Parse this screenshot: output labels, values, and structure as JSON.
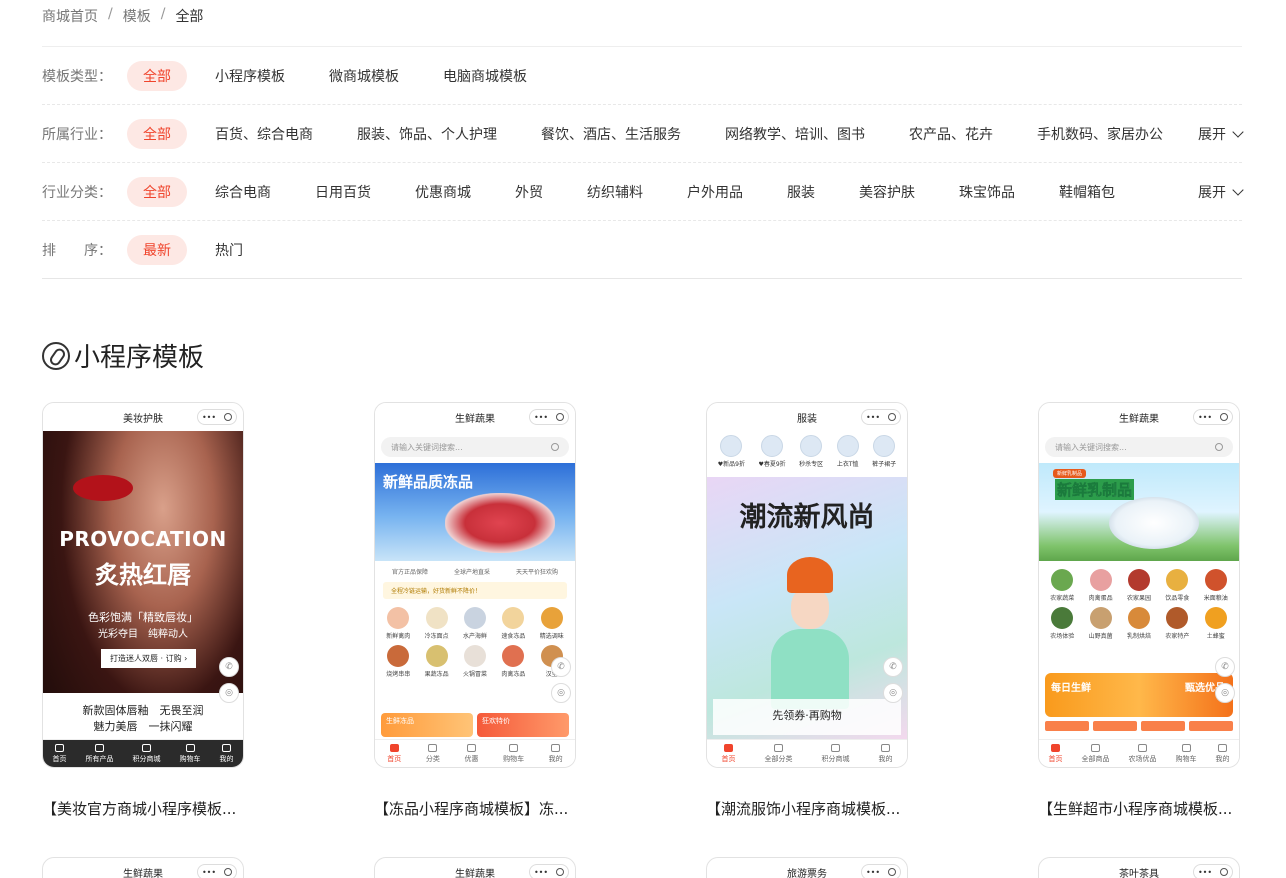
{
  "breadcrumb": [
    "商城首页",
    "模板",
    "全部"
  ],
  "filters": [
    {
      "label": "模板类型：",
      "options": [
        "全部",
        "小程序模板",
        "微商城模板",
        "电脑商城模板"
      ],
      "more": ""
    },
    {
      "label": "所属行业：",
      "options": [
        "全部",
        "百货、综合电商",
        "服装、饰品、个人护理",
        "餐饮、酒店、生活服务",
        "网络教学、培训、图书",
        "农产品、花卉",
        "手机数码、家居办公"
      ],
      "more": "展开"
    },
    {
      "label": "行业分类：",
      "options": [
        "全部",
        "综合电商",
        "日用百货",
        "优惠商城",
        "外贸",
        "纺织辅料",
        "户外用品",
        "服装",
        "美容护肤",
        "珠宝饰品",
        "鞋帽箱包"
      ],
      "more": "展开"
    },
    {
      "label": "排　　序：",
      "options": [
        "最新",
        "热门"
      ],
      "more": ""
    }
  ],
  "section_title": "小程序模板",
  "cards": [
    {
      "header": "美妆护肤",
      "caption": "【美妆官方商城小程序模板...",
      "big1": "PROVOCATION",
      "big2": "炙热红唇",
      "line1": "色彩饱满「精致唇妆」",
      "line2": "光彩夺目　纯粹动人",
      "btn": "打造迷人双唇 · 订购 ›",
      "foot1": "新款固体唇釉　无畏至润",
      "foot2": "魅力美唇　一抹闪耀",
      "tabs": [
        "首页",
        "所有产品",
        "积分商城",
        "购物车",
        "我的"
      ]
    },
    {
      "header": "生鲜蔬果",
      "caption": "【冻品小程序商城模板】冻...",
      "search": "请输入关键词搜索...",
      "banner": "新鲜品质冻品",
      "badges": [
        "官方正品保障",
        "全球产地直采",
        "天天平价狂欢购"
      ],
      "notice": "全程冷链运输，好货新鲜不降价！",
      "grid": [
        "新鲜禽肉",
        "冷冻面点",
        "水产海鲜",
        "速食冻品",
        "精选调味",
        "烧烤串串",
        "果蔬冻品",
        "火锅冒菜",
        "肉禽冻品",
        "汉堡"
      ],
      "promos": [
        "生鲜冻品",
        "狂欢特价"
      ],
      "tabs": [
        "首页",
        "分类",
        "优惠",
        "购物车",
        "我的"
      ]
    },
    {
      "header": "服装",
      "caption": "【潮流服饰小程序商城模板...",
      "icons": [
        "♥新品9折",
        "♥春夏9折",
        "秒杀专区",
        "上衣T恤",
        "裤子裙子"
      ],
      "banner": "潮流新风尚",
      "coupon": "先领券·再购物",
      "tabs": [
        "首页",
        "全部分类",
        "积分商城",
        "",
        "我的"
      ]
    },
    {
      "header": "生鲜蔬果",
      "caption": "【生鲜超市小程序商城模板...",
      "search": "请输入关键词搜索...",
      "tag": "新鲜乳制品",
      "banner": "新鲜乳制品",
      "grid": [
        "农家蔬菜",
        "肉禽蛋品",
        "农家果园",
        "饮品零食",
        "米面粮油",
        "农场体验",
        "山野真菌",
        "乳制烘焙",
        "农家特产",
        "土蜂蜜"
      ],
      "promo1": "每日生鲜",
      "promo2": "甄选优品",
      "tabs": [
        "首页",
        "全部商品",
        "农场优品",
        "购物车",
        "我的"
      ]
    }
  ],
  "bottom_cards": [
    "生鲜蔬果",
    "生鲜蔬果",
    "旅游票务",
    "茶叶茶具"
  ],
  "colors": {
    "accent": "#f0442c",
    "accent_bg": "#fde8e4"
  }
}
